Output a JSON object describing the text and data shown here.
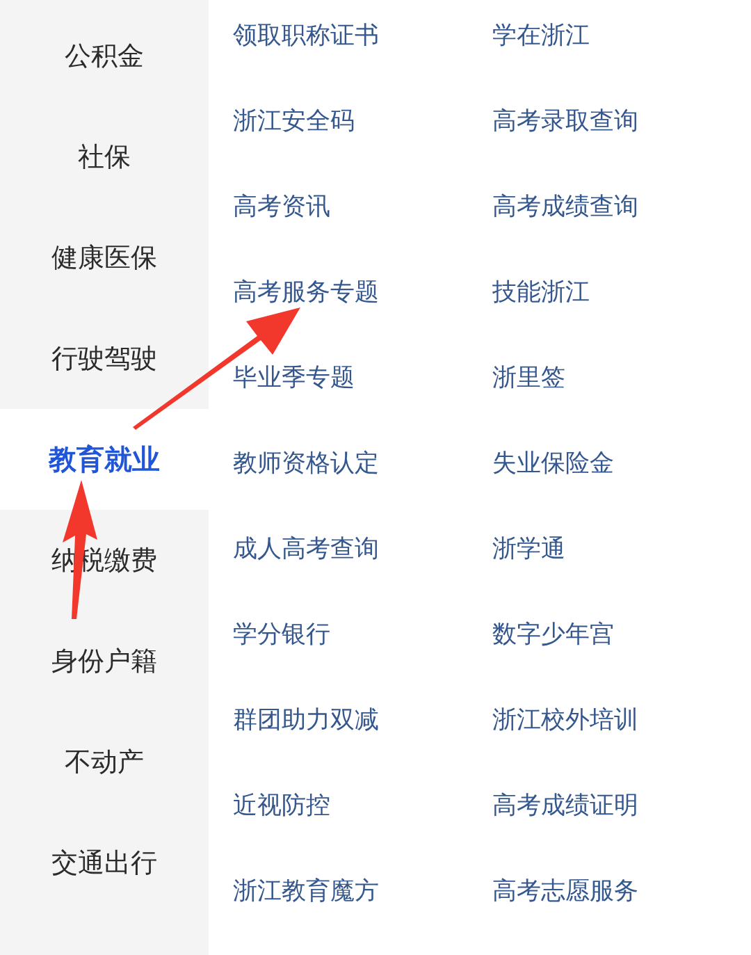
{
  "sidebar": {
    "items": [
      {
        "label": "公积金",
        "selected": false
      },
      {
        "label": "社保",
        "selected": false
      },
      {
        "label": "健康医保",
        "selected": false
      },
      {
        "label": "行驶驾驶",
        "selected": false
      },
      {
        "label": "教育就业",
        "selected": true
      },
      {
        "label": "纳税缴费",
        "selected": false
      },
      {
        "label": "身份户籍",
        "selected": false
      },
      {
        "label": "不动产",
        "selected": false
      },
      {
        "label": "交通出行",
        "selected": false
      }
    ]
  },
  "services": [
    "领取职称证书",
    "学在浙江",
    "浙江安全码",
    "高考录取查询",
    "高考资讯",
    "高考成绩查询",
    "高考服务专题",
    "技能浙江",
    "毕业季专题",
    "浙里签",
    "教师资格认定",
    "失业保险金",
    "成人高考查询",
    "浙学通",
    "学分银行",
    "数字少年宫",
    "群团助力双减",
    "浙江校外培训",
    "近视防控",
    "高考成绩证明",
    "浙江教育魔方",
    "高考志愿服务"
  ]
}
